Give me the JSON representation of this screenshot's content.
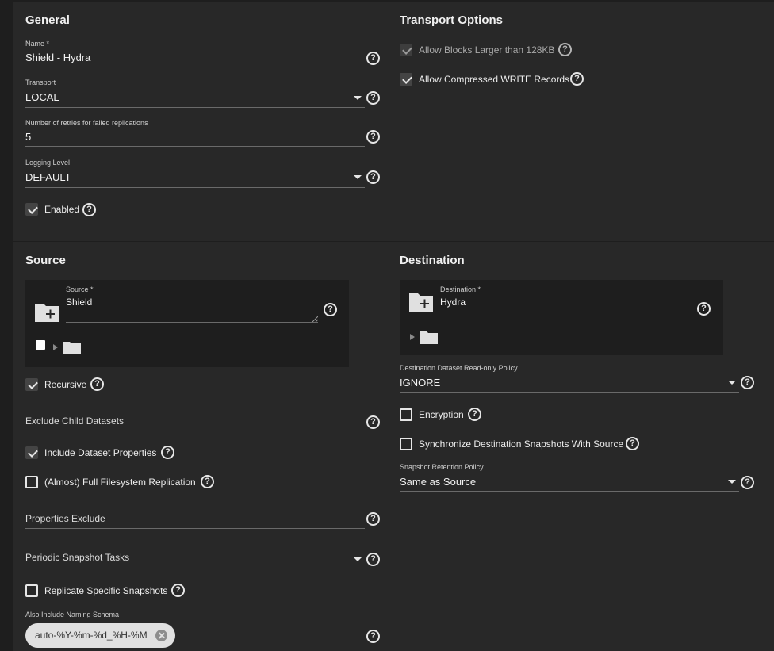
{
  "general": {
    "title": "General",
    "name": {
      "label": "Name *",
      "value": "Shield - Hydra"
    },
    "transport": {
      "label": "Transport",
      "value": "LOCAL"
    },
    "retries": {
      "label": "Number of retries for failed replications",
      "value": "5"
    },
    "logging": {
      "label": "Logging Level",
      "value": "DEFAULT"
    },
    "enabled": {
      "label": "Enabled",
      "checked": true
    }
  },
  "transport_options": {
    "title": "Transport Options",
    "allow_large": {
      "label": "Allow Blocks Larger than 128KB",
      "checked": true,
      "disabled": true
    },
    "allow_compressed": {
      "label": "Allow Compressed WRITE Records",
      "checked": true
    }
  },
  "source": {
    "title": "Source",
    "source_field": {
      "label": "Source *",
      "value": "Shield"
    },
    "recursive": {
      "label": "Recursive",
      "checked": true
    },
    "exclude_child": {
      "placeholder": "Exclude Child Datasets"
    },
    "include_props": {
      "label": "Include Dataset Properties",
      "checked": true
    },
    "full_fs": {
      "label": "(Almost) Full Filesystem Replication",
      "checked": false
    },
    "props_exclude": {
      "placeholder": "Properties Exclude"
    },
    "periodic": {
      "placeholder": "Periodic Snapshot Tasks"
    },
    "replicate_specific": {
      "label": "Replicate Specific Snapshots",
      "checked": false
    },
    "naming": {
      "label": "Also Include Naming Schema",
      "chip": "auto-%Y-%m-%d_%H-%M"
    }
  },
  "destination": {
    "title": "Destination",
    "dest_field": {
      "label": "Destination *",
      "value": "Hydra"
    },
    "readonly_policy": {
      "label": "Destination Dataset Read-only Policy",
      "value": "IGNORE"
    },
    "encryption": {
      "label": "Encryption",
      "checked": false
    },
    "sync_snapshots": {
      "label": "Synchronize Destination Snapshots With Source",
      "checked": false
    },
    "retention": {
      "label": "Snapshot Retention Policy",
      "value": "Same as Source"
    }
  },
  "icons": {
    "help": "help-circle-icon",
    "add_folder": "folder-plus-icon",
    "folder": "folder-icon",
    "dropdown": "caret-down-icon"
  },
  "help_glyph": "?"
}
